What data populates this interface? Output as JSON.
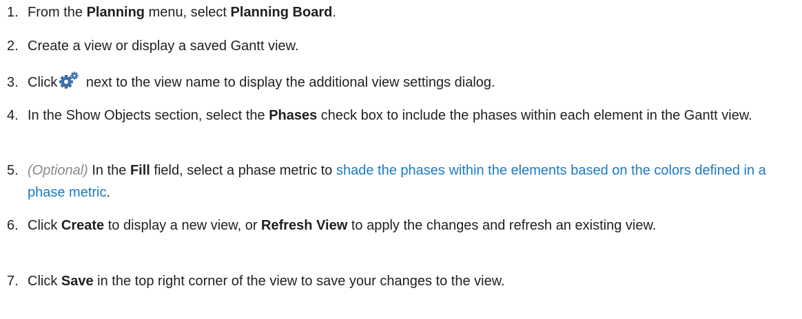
{
  "steps": [
    {
      "number": "1.",
      "parts": [
        "From the ",
        "Planning",
        " menu, select ",
        "Planning Board",
        "."
      ]
    },
    {
      "number": "2.",
      "text": "Create a view or display a saved Gantt view."
    },
    {
      "number": "3.",
      "before": "Click",
      "icon": "gear-settings-icon",
      "after": " next to the view name to display the additional view settings dialog."
    },
    {
      "number": "4.",
      "parts": [
        "In the Show Objects section, select the ",
        "Phases",
        " check box to include the phases within each element in the Gantt view."
      ]
    },
    {
      "number": "5.",
      "optional": "(Optional)",
      "parts": [
        " In the ",
        "Fill",
        " field, select a phase metric to "
      ],
      "link": "shade the phases within the elements based on the colors defined in a phase metric",
      "end": "."
    },
    {
      "number": "6.",
      "parts": [
        "Click ",
        "Create",
        " to display a new view, or ",
        "Refresh View",
        " to apply the changes and refresh an existing view."
      ]
    },
    {
      "number": "7.",
      "parts": [
        "Click ",
        "Save",
        " in the top right corner of the view to save your changes to the view."
      ]
    }
  ],
  "colors": {
    "text": "#1f1f1f",
    "link": "#1a79c4",
    "optional": "#8a8a8a",
    "icon": "#3a6fa8"
  }
}
